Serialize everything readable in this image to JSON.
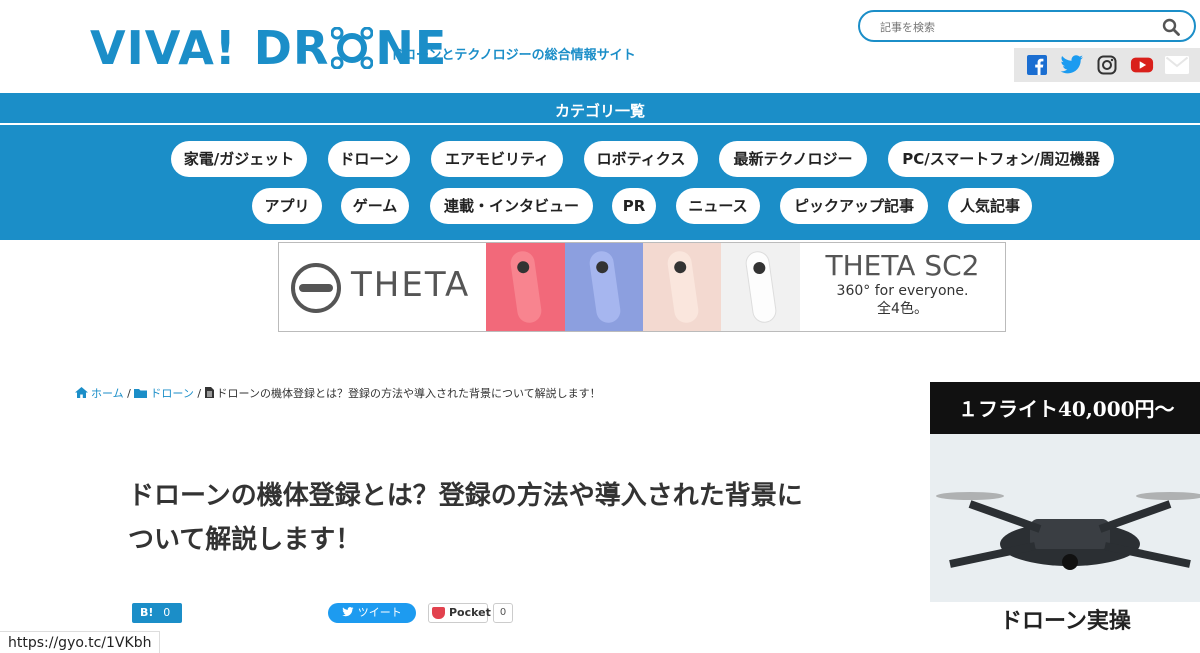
{
  "header": {
    "logo_part1": "VIVA! DR",
    "logo_part2": "NE",
    "tagline": "ドローンとテクノロジーの総合情報サイト"
  },
  "search": {
    "placeholder": "記事を検索"
  },
  "social": [
    "facebook-icon",
    "twitter-icon",
    "instagram-icon",
    "youtube-icon",
    "mail-icon"
  ],
  "categories": {
    "title": "カテゴリ一覧",
    "items": [
      "家電/ガジェット",
      "ドローン",
      "エアモビリティ",
      "ロボティクス",
      "最新テクノロジー",
      "PC/スマートフォン/周辺機器",
      "アプリ",
      "ゲーム",
      "連載・インタビュー",
      "PR",
      "ニュース",
      "ピックアップ記事",
      "人気記事"
    ]
  },
  "banner": {
    "brand": "THETA",
    "product": "THETA SC2",
    "tagline1": "360° for everyone.",
    "tagline2": "全4色。",
    "panel_colors": [
      "#f2697a",
      "#8c9fdf",
      "#f3d9d0",
      "#f1f1f1"
    ]
  },
  "breadcrumb": {
    "home": "ホーム",
    "category": "ドローン",
    "current": "ドローンの機体登録とは？登録の方法や導入された背景について解説します！"
  },
  "article": {
    "title": "ドローンの機体登録とは？登録の方法や導入された背景について解説します！"
  },
  "share": {
    "hatena_label": "B!",
    "hatena_count": "0",
    "tweet_label": "ツイート",
    "pocket_label": "Pocket",
    "pocket_count": "0"
  },
  "side_ad": {
    "headline": "１フライト40,000円〜",
    "bottom_text": "ドローン実操"
  },
  "status_url": "https://gyo.tc/1VKbh",
  "colors": {
    "brand": "#1b8ec8"
  }
}
